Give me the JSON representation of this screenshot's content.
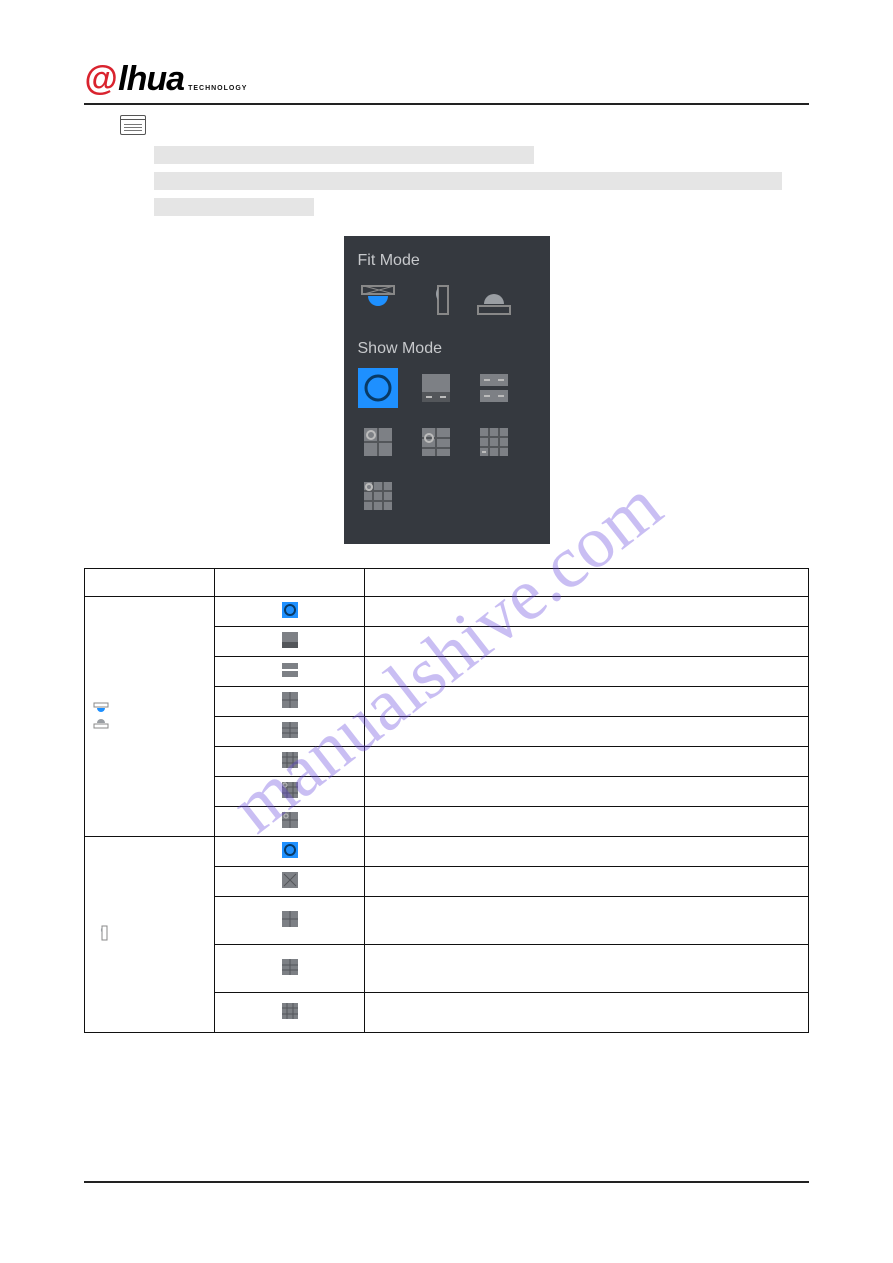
{
  "brand": {
    "prefix": "@",
    "name": "lhua",
    "tag": "TECHNOLOGY"
  },
  "watermark": "manualshive.com",
  "panel": {
    "fit_mode_label": "Fit Mode",
    "show_mode_label": "Show Mode",
    "fit_icons": [
      "ceiling-icon",
      "wall-icon",
      "ground-icon"
    ],
    "show_icons": [
      [
        "show-1o",
        "show-1p1",
        "show-2p"
      ],
      [
        "show-1r1",
        "show-1r2",
        "show-grid"
      ],
      [
        "show-grid2"
      ]
    ]
  },
  "table": {
    "headers": [
      "",
      "",
      ""
    ],
    "group_a": {
      "install_icons": [
        "ceiling-mini",
        "ground-mini"
      ],
      "rows": [
        {
          "mode_icon": "mini-1o-blue"
        },
        {
          "mode_icon": "mini-1p1"
        },
        {
          "mode_icon": "mini-2p"
        },
        {
          "mode_icon": "mini-1r1"
        },
        {
          "mode_icon": "mini-1r2"
        },
        {
          "mode_icon": "mini-grid"
        },
        {
          "mode_icon": "mini-grid2"
        },
        {
          "mode_icon": "mini-rgrid"
        }
      ]
    },
    "group_b": {
      "install_icon": "wall-mini",
      "rows": [
        {
          "mode_icon": "mini-1o-blue"
        },
        {
          "mode_icon": "mini-x"
        },
        {
          "mode_icon": "mini-1r1b"
        },
        {
          "mode_icon": "mini-1r2b"
        },
        {
          "mode_icon": "mini-gridx"
        }
      ]
    }
  }
}
